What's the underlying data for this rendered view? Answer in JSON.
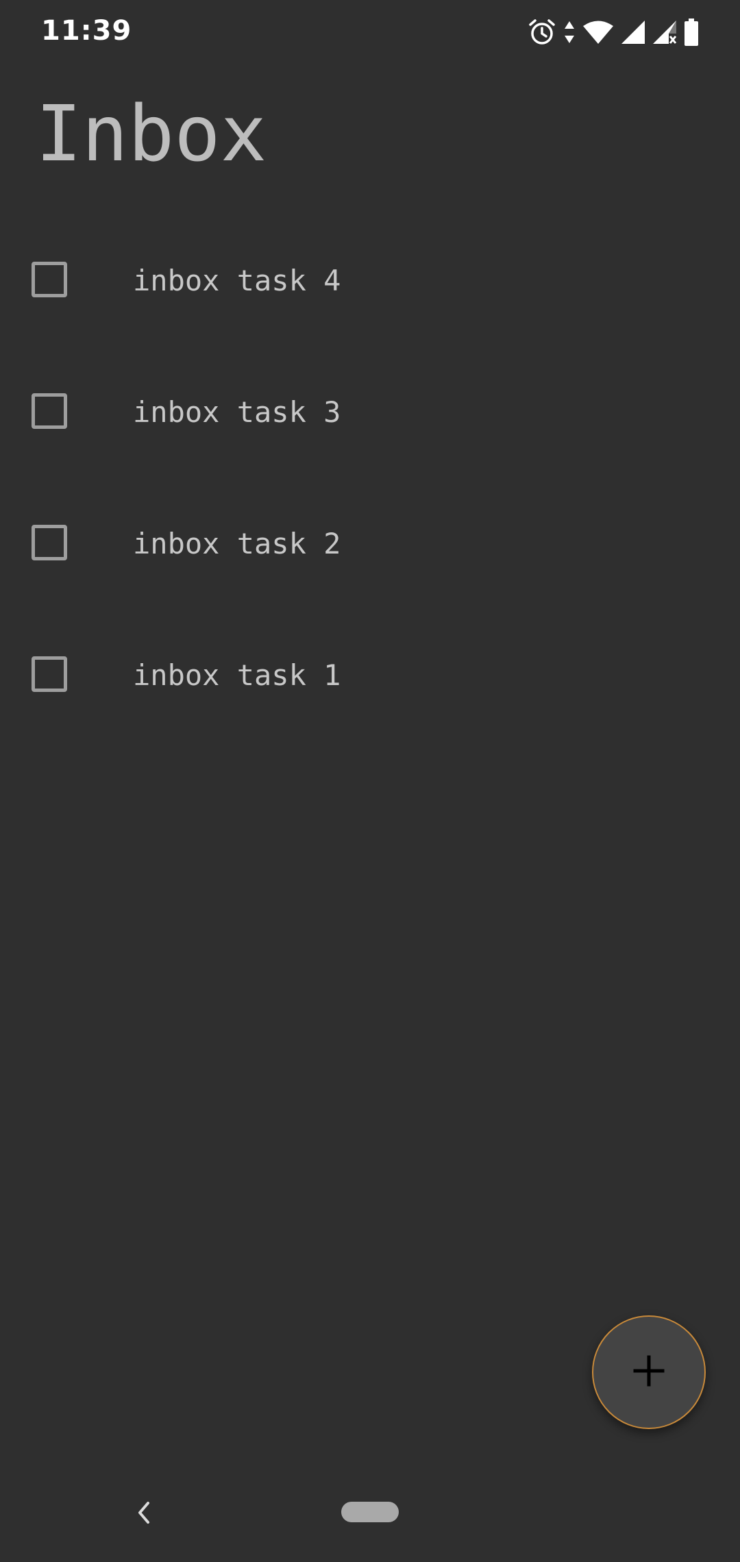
{
  "status_bar": {
    "time": "11:39",
    "icons": [
      "alarm-icon",
      "data-arrows-icon",
      "wifi-icon",
      "signal-icon",
      "signal-no-service-icon",
      "battery-icon"
    ]
  },
  "page": {
    "title": "Inbox"
  },
  "tasks": [
    {
      "label": "inbox task 4",
      "checked": false
    },
    {
      "label": "inbox task 3",
      "checked": false
    },
    {
      "label": "inbox task 2",
      "checked": false
    },
    {
      "label": "inbox task 1",
      "checked": false
    }
  ],
  "fab": {
    "icon": "plus-icon",
    "accent_color": "#c98a3a"
  },
  "nav_bar": {
    "icons": [
      "back-icon",
      "home-pill"
    ]
  },
  "colors": {
    "background": "#2f2f2f",
    "title": "#bdbdbd",
    "task_text": "#c8c8c8",
    "checkbox_border": "#9e9e9e"
  }
}
